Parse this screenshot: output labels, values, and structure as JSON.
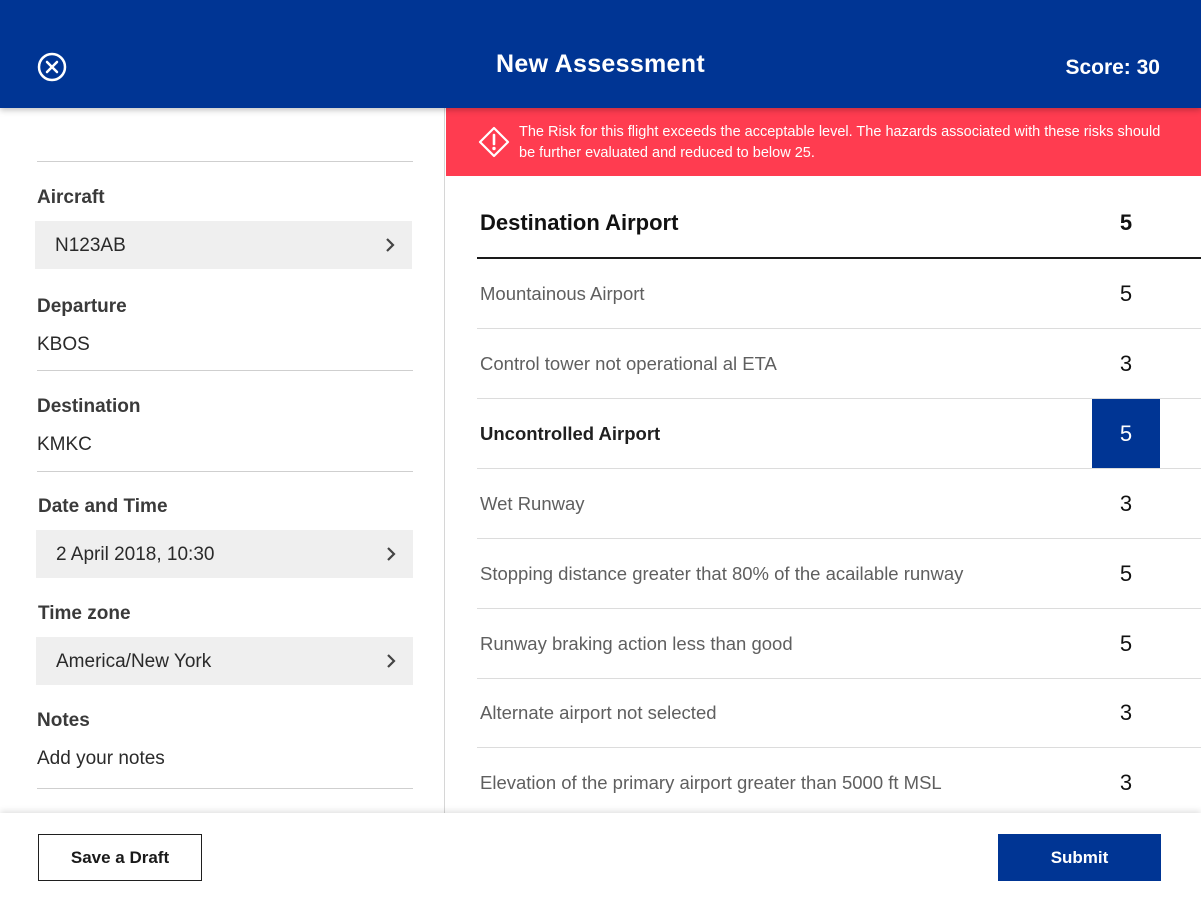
{
  "header": {
    "title": "New Assessment",
    "score_label": "Score: 30",
    "close_icon": "close-circle-icon"
  },
  "alert": {
    "icon": "warning-diamond-icon",
    "message": "The Risk for this flight exceeds the acceptable level. The hazards associated with these risks should be further evaluated and reduced to below 25.",
    "color": "#ff3c50"
  },
  "form": {
    "aircraft": {
      "label": "Aircraft",
      "value": "N123AB"
    },
    "departure": {
      "label": "Departure",
      "value": "KBOS"
    },
    "destination": {
      "label": "Destination",
      "value": "KMKC"
    },
    "datetime": {
      "label": "Date and Time",
      "value": "2 April 2018, 10:30"
    },
    "timezone": {
      "label": "Time zone",
      "value": "America/New York"
    },
    "notes": {
      "label": "Notes",
      "value": "Add your notes"
    }
  },
  "hazards": {
    "title": "Destination Airport",
    "total": "5",
    "items": [
      {
        "label": "Mountainous Airport",
        "score": "5",
        "selected": false
      },
      {
        "label": "Control tower not operational al ETA",
        "score": "3",
        "selected": false
      },
      {
        "label": "Uncontrolled Airport",
        "score": "5",
        "selected": true
      },
      {
        "label": "Wet Runway",
        "score": "3",
        "selected": false
      },
      {
        "label": "Stopping distance greater that 80% of the acailable runway",
        "score": "5",
        "selected": false
      },
      {
        "label": "Runway braking action less than good",
        "score": "5",
        "selected": false
      },
      {
        "label": "Alternate airport not selected",
        "score": "3",
        "selected": false
      },
      {
        "label": "Elevation of the primary airport greater than 5000 ft MSL",
        "score": "3",
        "selected": false
      }
    ]
  },
  "footer": {
    "save_draft_label": "Save a Draft",
    "submit_label": "Submit"
  },
  "colors": {
    "primary": "#003594",
    "alert": "#ff3c50"
  }
}
